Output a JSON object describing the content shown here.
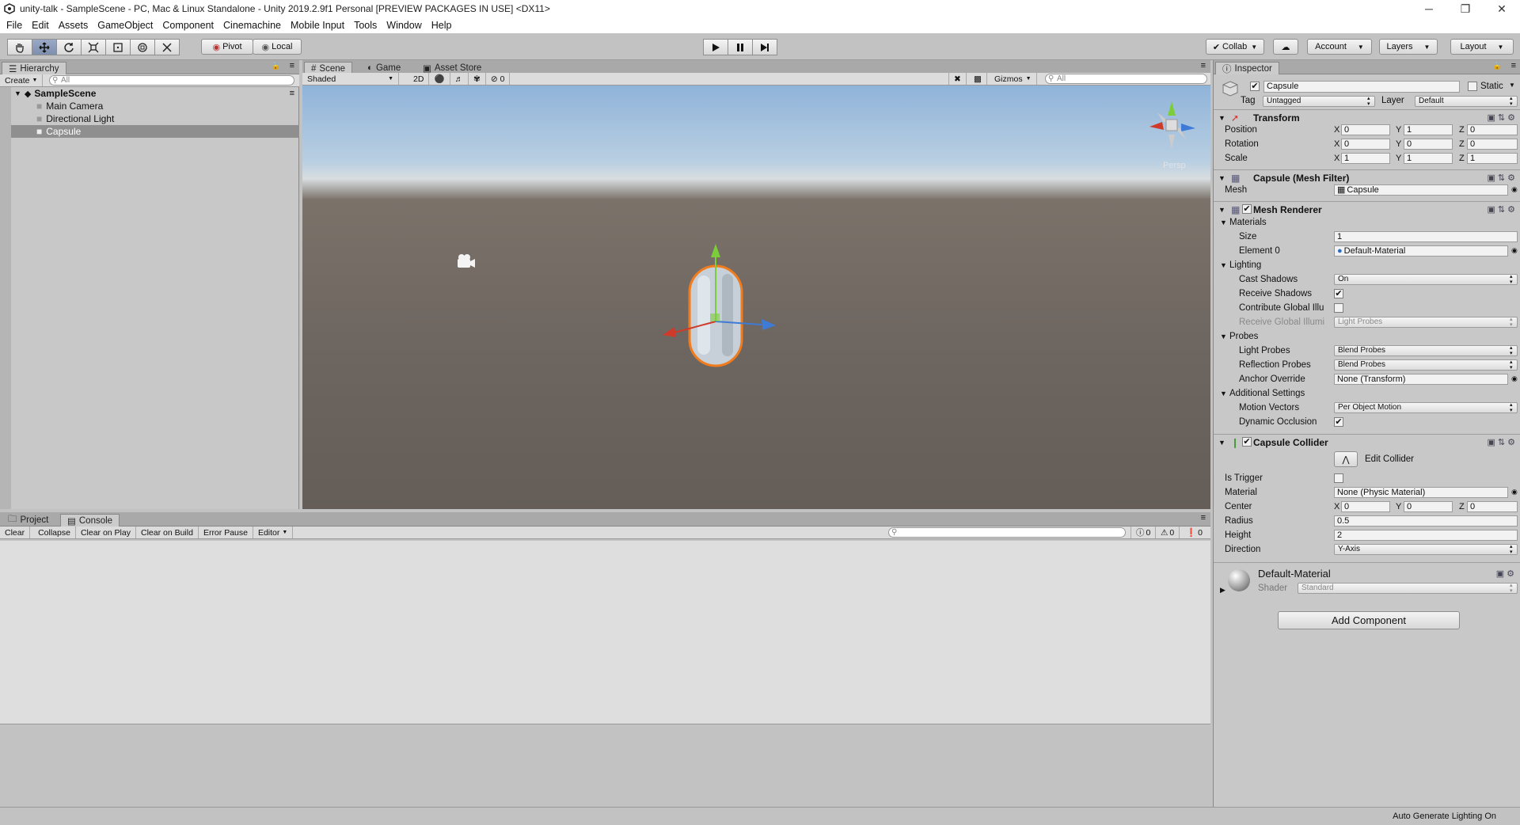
{
  "window": {
    "title": "unity-talk - SampleScene - PC, Mac & Linux Standalone - Unity 2019.2.9f1 Personal [PREVIEW PACKAGES IN USE] <DX11>",
    "controls": [
      "─",
      "❐",
      "✕"
    ]
  },
  "menu": [
    "File",
    "Edit",
    "Assets",
    "GameObject",
    "Component",
    "Cinemachine",
    "Mobile Input",
    "Tools",
    "Window",
    "Help"
  ],
  "toolbar": {
    "pivot": "Pivot",
    "local": "Local",
    "collab": "Collab",
    "account": "Account",
    "layers": "Layers",
    "layout": "Layout"
  },
  "hierarchy": {
    "tab": "Hierarchy",
    "create": "Create",
    "search_placeholder": "All",
    "scene": "SampleScene",
    "items": [
      "Main Camera",
      "Directional Light",
      "Capsule"
    ],
    "selected": "Capsule"
  },
  "scene": {
    "tabs": [
      "Scene",
      "Game",
      "Asset Store"
    ],
    "active_tab": "Scene",
    "shading": "Shaded",
    "mode_2d": "2D",
    "hidden_count": "0",
    "gizmos": "Gizmos",
    "search_placeholder": "All",
    "persp": "Persp"
  },
  "console": {
    "tabs": [
      "Project",
      "Console"
    ],
    "active_tab": "Console",
    "buttons": [
      "Clear",
      "Collapse",
      "Clear on Play",
      "Clear on Build",
      "Error Pause",
      "Editor"
    ],
    "counts": {
      "info": "0",
      "warn": "0",
      "error": "0"
    }
  },
  "inspector": {
    "tab": "Inspector",
    "object_name": "Capsule",
    "static_label": "Static",
    "tag_label": "Tag",
    "tag": "Untagged",
    "layer_label": "Layer",
    "layer": "Default",
    "transform": {
      "title": "Transform",
      "position_label": "Position",
      "position": [
        "0",
        "1",
        "0"
      ],
      "rotation_label": "Rotation",
      "rotation": [
        "0",
        "0",
        "0"
      ],
      "scale_label": "Scale",
      "scale": [
        "1",
        "1",
        "1"
      ]
    },
    "mesh_filter": {
      "title": "Capsule (Mesh Filter)",
      "mesh_label": "Mesh",
      "mesh": "Capsule"
    },
    "mesh_renderer": {
      "title": "Mesh Renderer",
      "materials": "Materials",
      "size_label": "Size",
      "size": "1",
      "element0_label": "Element 0",
      "element0": "Default-Material",
      "lighting": "Lighting",
      "cast_shadows_label": "Cast Shadows",
      "cast_shadows": "On",
      "receive_shadows_label": "Receive Shadows",
      "contribute_gi_label": "Contribute Global Illu",
      "receive_gi_label": "Receive Global Illumi",
      "receive_gi": "Light Probes",
      "probes": "Probes",
      "light_probes_label": "Light Probes",
      "light_probes": "Blend Probes",
      "reflection_probes_label": "Reflection Probes",
      "reflection_probes": "Blend Probes",
      "anchor_override_label": "Anchor Override",
      "anchor_override": "None (Transform)",
      "additional": "Additional Settings",
      "motion_vectors_label": "Motion Vectors",
      "motion_vectors": "Per Object Motion",
      "dynamic_occlusion_label": "Dynamic Occlusion"
    },
    "capsule_collider": {
      "title": "Capsule Collider",
      "edit_collider": "Edit Collider",
      "is_trigger_label": "Is Trigger",
      "material_label": "Material",
      "material": "None (Physic Material)",
      "center_label": "Center",
      "center": [
        "0",
        "0",
        "0"
      ],
      "radius_label": "Radius",
      "radius": "0.5",
      "height_label": "Height",
      "height": "2",
      "direction_label": "Direction",
      "direction": "Y-Axis"
    },
    "material": {
      "name": "Default-Material",
      "shader_label": "Shader",
      "shader": "Standard"
    },
    "add_component": "Add Component"
  },
  "status": {
    "text": "Auto Generate Lighting On"
  },
  "colors": {
    "selection": "#8f8f8f",
    "scene_ground": "#6e6660",
    "sky": "#8fb3d9",
    "capsule_outline": "#f07c1e"
  }
}
